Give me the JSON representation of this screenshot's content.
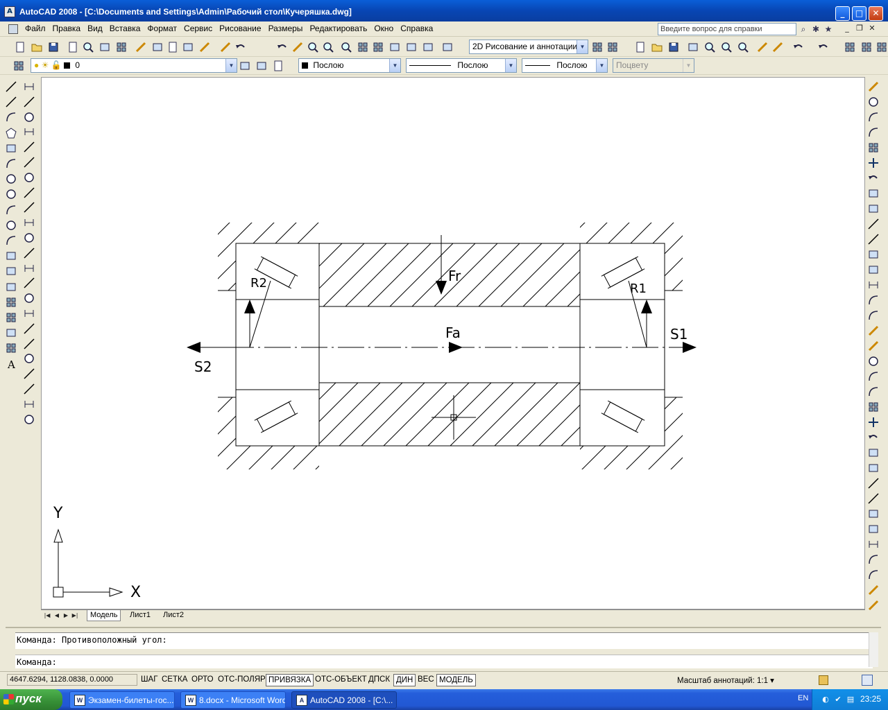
{
  "window": {
    "title": "AutoCAD 2008 - [C:\\Documents and Settings\\Admin\\Рабочий стол\\Кучеряшка.dwg]",
    "minimize": "_",
    "maximize": "□",
    "close": "✕"
  },
  "menu": {
    "items": [
      "Файл",
      "Правка",
      "Вид",
      "Вставка",
      "Формат",
      "Сервис",
      "Рисование",
      "Размеры",
      "Редактировать",
      "Окно",
      "Справка"
    ],
    "help_placeholder": "Введите вопрос для справки"
  },
  "toolbar": {
    "workspace": "2D Рисование и аннотации",
    "layer": "0",
    "color": "Послою",
    "linetype": "Послою",
    "lineweight": "Послою",
    "plotstyle": "Поцвету"
  },
  "drawing": {
    "labels": {
      "fr": "Fr",
      "fa": "Fa",
      "r1": "R1",
      "r2": "R2",
      "s1": "S1",
      "s2": "S2",
      "axis_x": "X",
      "axis_y": "Y"
    }
  },
  "tabs": [
    "Модель",
    "Лист1",
    "Лист2"
  ],
  "command": {
    "line1": "Команда: Противоположный угол:",
    "line2": "Команда:"
  },
  "status": {
    "coords": "4647.6294, 1128.0838, 0.0000",
    "buttons": [
      {
        "label": "ШАГ",
        "on": false
      },
      {
        "label": "СЕТКА",
        "on": false
      },
      {
        "label": "ОРТО",
        "on": false
      },
      {
        "label": "ОТС-ПОЛЯР",
        "on": false
      },
      {
        "label": "ПРИВЯЗКА",
        "on": true
      },
      {
        "label": "ОТС-ОБЪЕКТ",
        "on": false
      },
      {
        "label": "ДПСК",
        "on": false
      },
      {
        "label": "ДИН",
        "on": true
      },
      {
        "label": "ВЕС",
        "on": false
      },
      {
        "label": "МОДЕЛЬ",
        "on": true
      }
    ],
    "annotation_scale": "Масштаб аннотаций: 1:1 ▾"
  },
  "taskbar": {
    "start": "пуск",
    "tasks": [
      {
        "label": "Экзамен-билеты-гос...",
        "active": false
      },
      {
        "label": "8.docx - Microsoft Word",
        "active": false
      },
      {
        "label": "AutoCAD 2008 - [C:\\...",
        "active": true
      }
    ],
    "lang": "EN",
    "clock": "23:25"
  },
  "colors": {
    "titlebar": "#0846b4",
    "taskbar": "#245edb",
    "start": "#368f36",
    "canvas": "#ffffff"
  }
}
